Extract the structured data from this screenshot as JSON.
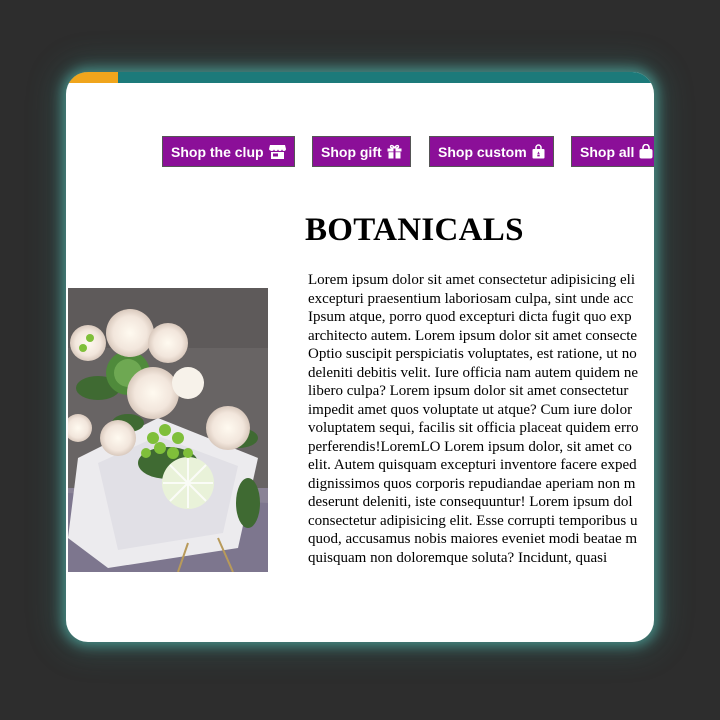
{
  "nav": {
    "buttons": [
      {
        "label": "Shop the clup",
        "icon": "store-icon"
      },
      {
        "label": "Shop gift",
        "icon": "gift-icon"
      },
      {
        "label": "Shop custom",
        "icon": "shopping-bag-icon"
      },
      {
        "label": "Shop all",
        "icon": "shopping-bag-icon"
      }
    ]
  },
  "main": {
    "title": "BOTANICALS",
    "body_lines": "Lorem ipsum dolor sit amet consectetur adipisicing eli\nexcepturi praesentium laboriosam culpa, sint unde acc\nIpsum atque, porro quod excepturi dicta fugit quo exp\narchitecto autem. Lorem ipsum dolor sit amet consecte\nOptio suscipit perspiciatis voluptates, est ratione, ut no\ndeleniti debitis velit. Iure officia nam autem quidem ne\nlibero culpa? Lorem ipsum dolor sit amet consectetur\nimpedit amet quos voluptate ut atque? Cum iure dolor\nvoluptatem sequi, facilis sit officia placeat quidem erro\nperferendis!LoremLO Lorem ipsum dolor, sit amet co\nelit. Autem quisquam excepturi inventore facere exped\ndignissimos quos corporis repudiandae aperiam non m\ndeserunt deleniti, iste consequuntur! Lorem ipsum dol\nconsectetur adipisicing elit. Esse corrupti temporibus u\nquod, accusamus nobis maiores eveniet modi beatae m\nquisquam non doloremque soluta? Incidunt, quasi"
  },
  "colors": {
    "page_bg": "#2d2d2d",
    "card_bg": "#ffffff",
    "top_bar": "#1c7a7a",
    "top_bar_accent": "#f0a51c",
    "button_bg": "#8b0f98",
    "glow": "#5ac8be"
  }
}
